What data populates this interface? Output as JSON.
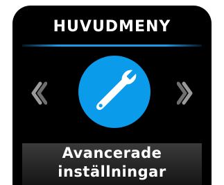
{
  "menu": {
    "title": "HUVUDMENY",
    "selected_item": {
      "icon": "wrench-icon",
      "label_line1": "Avancerade",
      "label_line2": "inställningar"
    }
  },
  "colors": {
    "accent": "#0a9bea",
    "background": "#000000",
    "text": "#ffffff"
  }
}
